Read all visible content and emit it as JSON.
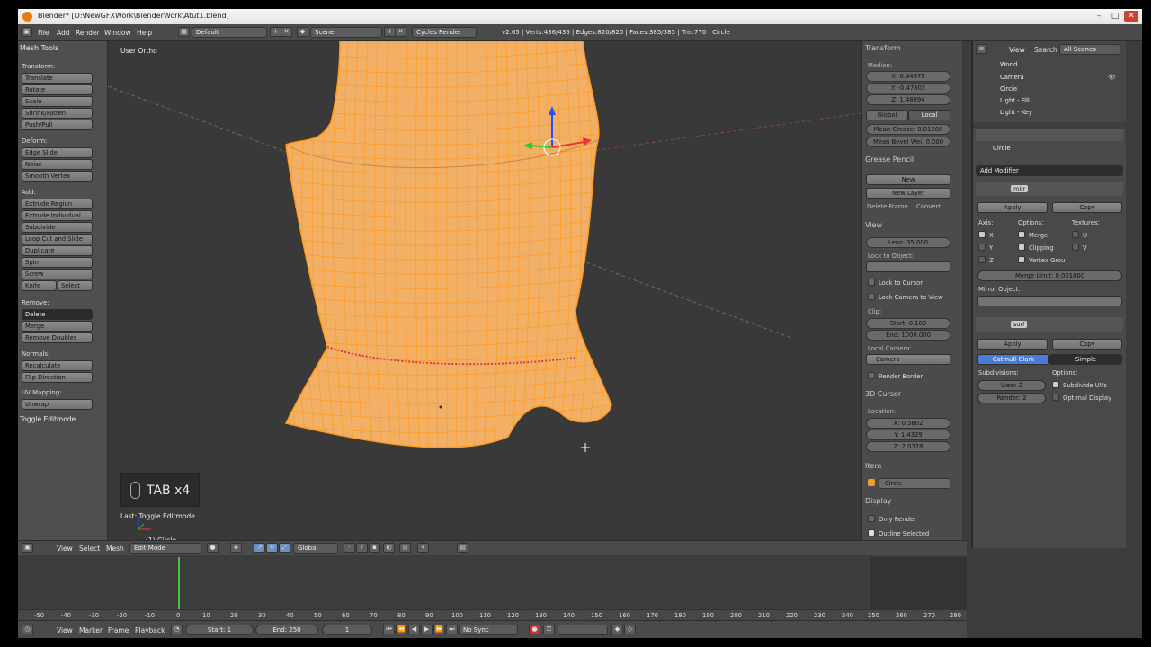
{
  "window": {
    "title": "Blender* [D:\\NewGFXWork\\BlenderWork\\Atut1.blend]",
    "minimize": "–",
    "maximize": "□",
    "close": "✕"
  },
  "info_header": {
    "menus": [
      "File",
      "Add",
      "Render",
      "Window",
      "Help"
    ],
    "screen_layout": "Default",
    "scene": "Scene",
    "render_engine": "Cycles Render",
    "stats": "v2.65 | Verts:436/436 | Edges:820/820 | Faces:385/385 | Tris:770 | Circle"
  },
  "tool_shelf": {
    "title": "Mesh Tools",
    "transform_label": "Transform:",
    "transform": [
      "Translate",
      "Rotate",
      "Scale",
      "Shrink/Fatten",
      "Push/Pull"
    ],
    "deform_label": "Deform:",
    "deform": [
      "Edge Slide",
      "Noise",
      "Smooth Vertex"
    ],
    "add_label": "Add:",
    "add": [
      "Extrude Region",
      "Extrude Individual",
      "Subdivide",
      "Loop Cut and Slide",
      "Duplicate",
      "Spin",
      "Screw"
    ],
    "knife": "Knife",
    "select": "Select",
    "remove_label": "Remove:",
    "delete": "Delete",
    "merge": "Merge",
    "remove_doubles": "Remove Doubles",
    "normals_label": "Normals:",
    "normals": [
      "Recalculate",
      "Flip Direction"
    ],
    "uv_label": "UV Mapping:",
    "unwrap": "Unwrap",
    "toggle_editmode": "Toggle Editmode"
  },
  "viewport": {
    "view_label": "User Ortho",
    "key_overlay": "TAB x4",
    "last_operator": "Last: Toggle Editmode",
    "object_name": "(1) Circle",
    "mesh_color": "#f2b066",
    "wire_color": "#ff9a1f"
  },
  "n_panel": {
    "transform_title": "Transform",
    "median_label": "Median:",
    "x": "X: 0.44975",
    "y": "Y: -0.47802",
    "z": "Z: 1.48894",
    "global": "Global",
    "local": "Local",
    "mean_crease": "Mean Crease: 0.01585",
    "mean_bevel": "Mean Bevel Wei: 0.000",
    "grease_title": "Grease Pencil",
    "new": "New",
    "new_layer": "New Layer",
    "delete_frame": "Delete Frame",
    "convert": "Convert",
    "view_title": "View",
    "lens": "Lens: 35.000",
    "lock_to_object": "Lock to Object:",
    "lock_to_cursor": "Lock to Cursor",
    "lock_camera": "Lock Camera to View",
    "clip_label": "Clip:",
    "clip_start": "Start: 0.100",
    "clip_end": "End: 1000.000",
    "local_camera": "Local Camera:",
    "camera": "Camera",
    "render_border": "Render Border",
    "cursor_title": "3D Cursor",
    "location_label": "Location:",
    "cx": "X: 0.5802",
    "cy": "Y: 1.4329",
    "cz": "Z: 2.0378",
    "item_title": "Item",
    "item_name": "Circle",
    "display_title": "Display",
    "only_render": "Only Render",
    "outline_selected": "Outline Selected"
  },
  "outliner": {
    "view": "View",
    "search": "Search",
    "filter": "All Scenes",
    "items": [
      "World",
      "Camera",
      "Circle",
      "Light - Fill",
      "Light - Key"
    ]
  },
  "properties": {
    "object_name": "Circle",
    "add_modifier": "Add Modifier",
    "mirror": {
      "name": "mirr",
      "apply": "Apply",
      "copy": "Copy",
      "axis_label": "Axis:",
      "options_label": "Options:",
      "textures_label": "Textures:",
      "x": "X",
      "y": "Y",
      "z": "Z",
      "merge": "Merge",
      "clipping": "Clipping",
      "vertex_groups": "Vertex Grou",
      "u": "U",
      "v": "V",
      "merge_limit": "Merge Limit: 0.001000",
      "mirror_object": "Mirror Object:"
    },
    "subsurf": {
      "name": "surf",
      "apply": "Apply",
      "copy": "Copy",
      "catmull": "Catmull-Clark",
      "simple": "Simple",
      "subdivisions_label": "Subdivisions:",
      "options_label": "Options:",
      "view": "View: 2",
      "render": "Render: 2",
      "subdivide_uvs": "Subdivide UVs",
      "optimal_display": "Optimal Display"
    }
  },
  "viewport_header": {
    "view": "View",
    "select": "Select",
    "mesh": "Mesh",
    "mode": "Edit Mode",
    "orientation": "Global"
  },
  "timeline": {
    "ticks": [
      "-50",
      "-40",
      "-30",
      "-20",
      "-10",
      "0",
      "10",
      "20",
      "30",
      "40",
      "50",
      "60",
      "70",
      "80",
      "90",
      "100",
      "110",
      "120",
      "130",
      "140",
      "150",
      "160",
      "170",
      "180",
      "190",
      "200",
      "210",
      "220",
      "230",
      "240",
      "250",
      "260",
      "270",
      "280"
    ],
    "menus": [
      "View",
      "Marker",
      "Frame",
      "Playback"
    ],
    "start": "Start: 1",
    "end": "End: 250",
    "current": "1",
    "sync": "No Sync"
  }
}
